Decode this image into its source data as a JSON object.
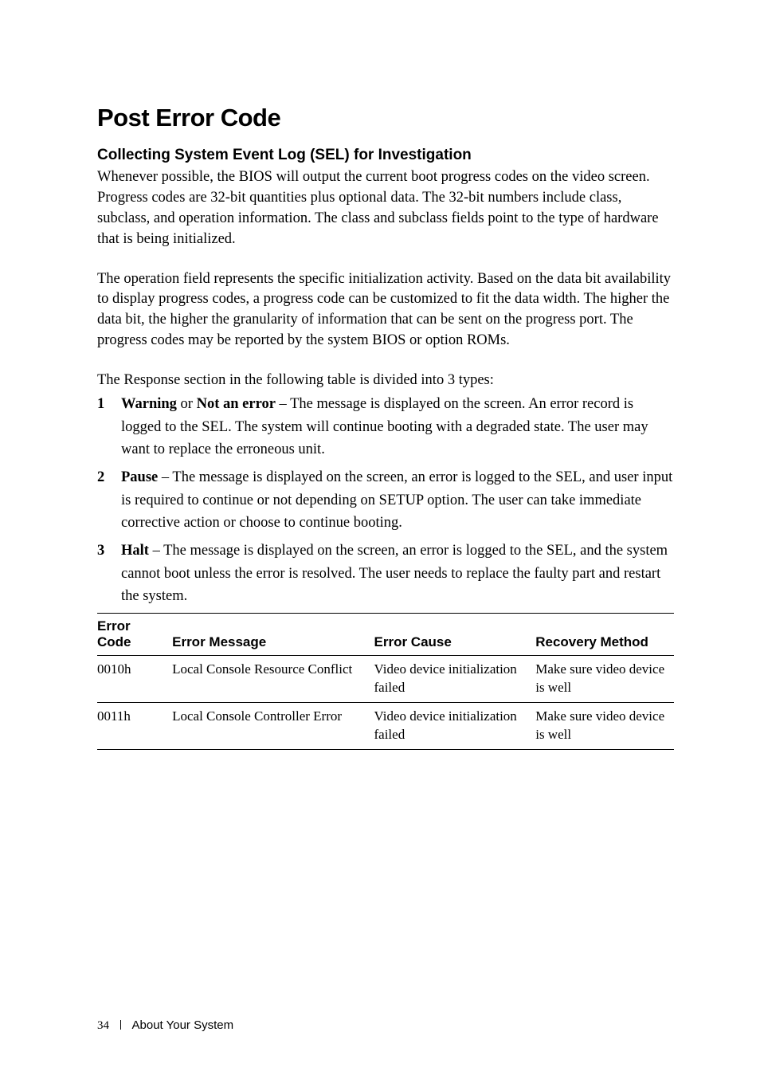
{
  "title": "Post Error Code",
  "subheading": "Collecting System Event Log (SEL) for Investigation",
  "para1": "Whenever possible, the BIOS will output the current boot progress codes on the video screen. Progress codes are 32-bit quantities plus optional data. The 32-bit numbers include class, subclass, and operation information. The class and subclass fields point to the type of hardware that is being initialized.",
  "para2": "The operation field represents the specific initialization activity. Based on the data bit availability to display progress codes, a progress code can be customized to fit the data width. The higher the data bit, the higher the granularity of information that can be sent on the progress port. The progress codes may be reported by the system BIOS or option ROMs.",
  "intro": "The Response section in the following table is divided into 3 types:",
  "list": [
    {
      "bold": "Warning",
      "mid": " or ",
      "bold2": "Not an error",
      "rest": " – The message is displayed on the screen. An error record is logged to the SEL. The system will continue booting with a degraded state. The user may want to replace the erroneous unit."
    },
    {
      "bold": "Pause",
      "rest": " – The message is displayed on the screen, an error is logged to the SEL, and user input is required to continue or not depending on SETUP option. The user can take immediate corrective action or choose to continue booting."
    },
    {
      "bold": "Halt",
      "rest": " – The message is displayed on the screen, an error is logged to the SEL, and the system cannot boot unless the error is resolved. The user needs to replace the faulty part and restart the system."
    }
  ],
  "table": {
    "headers": {
      "code": "Error Code",
      "message": "Error Message",
      "cause": "Error Cause",
      "recovery": "Recovery Method"
    },
    "rows": [
      {
        "code": "0010h",
        "message": "Local Console Resource Conflict",
        "cause": "Video device initialization failed",
        "recovery": "Make sure video device is well"
      },
      {
        "code": "0011h",
        "message": "Local Console Controller Error",
        "cause": "Video device initialization failed",
        "recovery": "Make sure video device is well"
      }
    ]
  },
  "footer": {
    "page": "34",
    "section": "About Your System"
  }
}
